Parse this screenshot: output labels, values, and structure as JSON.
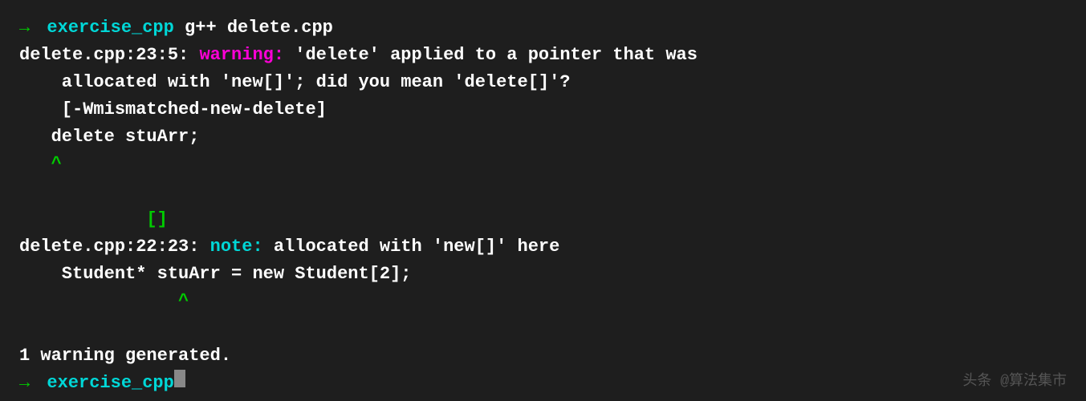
{
  "terminal": {
    "lines": [
      {
        "id": "line1",
        "parts": [
          {
            "type": "arrow",
            "text": "→ "
          },
          {
            "type": "cyan",
            "text": "exercise_cpp"
          },
          {
            "type": "white",
            "text": " g++ delete.cpp"
          }
        ]
      },
      {
        "id": "line2",
        "parts": [
          {
            "type": "white",
            "text": "delete.cpp:23:5: "
          },
          {
            "type": "magenta",
            "text": "warning:"
          },
          {
            "type": "white",
            "text": " 'delete' "
          },
          {
            "type": "white",
            "text": "applied to a pointer that was"
          }
        ]
      },
      {
        "id": "line3",
        "parts": [
          {
            "type": "white",
            "text": "    allocated with 'new[]'; did you mean 'delete[]'?"
          }
        ]
      },
      {
        "id": "line4",
        "parts": [
          {
            "type": "white",
            "text": "    [-Wmismatched-new-delete]"
          }
        ]
      },
      {
        "id": "line5",
        "parts": [
          {
            "type": "white",
            "text": "   delete stuArr;"
          }
        ]
      },
      {
        "id": "line6",
        "parts": [
          {
            "type": "green",
            "text": "   ^"
          }
        ]
      },
      {
        "id": "line7",
        "parts": [
          {
            "type": "white",
            "text": ""
          }
        ]
      },
      {
        "id": "line8",
        "parts": [
          {
            "type": "green",
            "text": "            []"
          }
        ]
      },
      {
        "id": "line9",
        "parts": [
          {
            "type": "white",
            "text": "delete.cpp:22:23: "
          },
          {
            "type": "cyan",
            "text": "note:"
          },
          {
            "type": "white",
            "text": " allocated with 'new[]' here"
          }
        ]
      },
      {
        "id": "line10",
        "parts": [
          {
            "type": "white",
            "text": "    Student* stuArr = new Student[2];"
          }
        ]
      },
      {
        "id": "line11",
        "parts": [
          {
            "type": "green",
            "text": "               ^"
          }
        ]
      },
      {
        "id": "line12",
        "parts": [
          {
            "type": "white",
            "text": ""
          }
        ]
      },
      {
        "id": "line13",
        "parts": [
          {
            "type": "white",
            "text": "1 warning generated."
          }
        ]
      },
      {
        "id": "line14",
        "parts": [
          {
            "type": "arrow",
            "text": "→ "
          },
          {
            "type": "cyan",
            "text": "exercise_cpp"
          },
          {
            "type": "cursor",
            "text": " "
          }
        ]
      }
    ]
  },
  "watermark": {
    "text": "头条 @算法集市"
  }
}
